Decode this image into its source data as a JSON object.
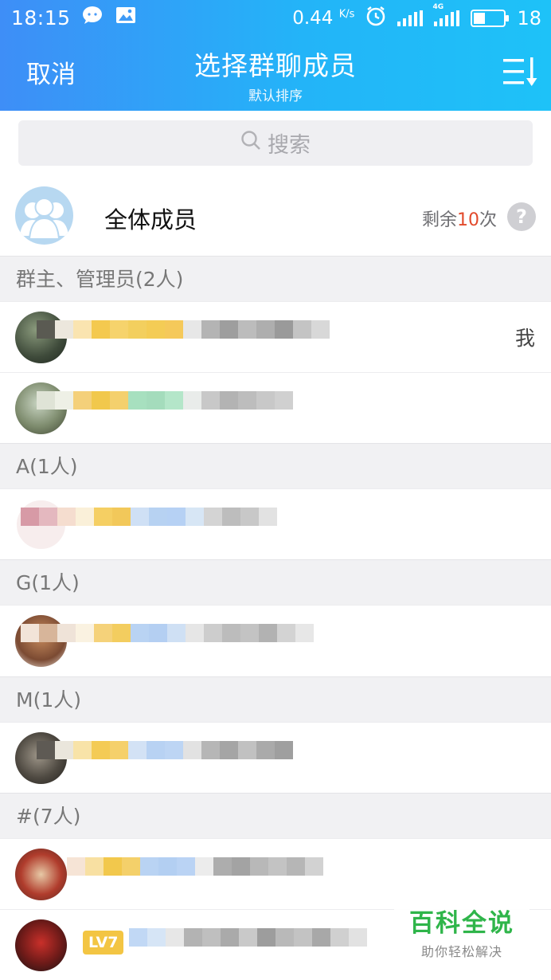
{
  "status_bar": {
    "time": "18:15",
    "speed": "0.44",
    "speed_unit": "K/s",
    "network": "4G",
    "battery": "18",
    "icons": [
      "wechat-icon",
      "image-icon",
      "alarm-icon",
      "signal-icon",
      "4g-signal-icon",
      "battery-icon"
    ]
  },
  "nav": {
    "cancel_label": "取消",
    "title": "选择群聊成员",
    "subtitle": "默认排序",
    "sort_icon": "sort-list-icon"
  },
  "search": {
    "placeholder": "搜索",
    "icon": "search-icon"
  },
  "all_members": {
    "label": "全体成员",
    "quota_prefix": "剩余",
    "quota_count": "10",
    "quota_suffix": "次",
    "help_icon": "?"
  },
  "sections": [
    {
      "header": "群主、管理员(2人)",
      "members": [
        {
          "tag": "我"
        },
        {
          "tag": ""
        }
      ]
    },
    {
      "header": "A(1人)",
      "members": [
        {
          "tag": ""
        }
      ]
    },
    {
      "header": "G(1人)",
      "members": [
        {
          "tag": ""
        }
      ]
    },
    {
      "header": "M(1人)",
      "members": [
        {
          "tag": ""
        }
      ]
    },
    {
      "header": "#(7人)",
      "members": [
        {
          "tag": ""
        },
        {
          "badge": "LV7"
        }
      ]
    }
  ],
  "watermark": {
    "title": "百科全说",
    "subtitle": "助你轻松解决"
  },
  "colors": {
    "header_start": "#3e8ef7",
    "header_end": "#1ec2f8",
    "quota_accent": "#e24a2c",
    "watermark_green": "#2fb54a"
  }
}
